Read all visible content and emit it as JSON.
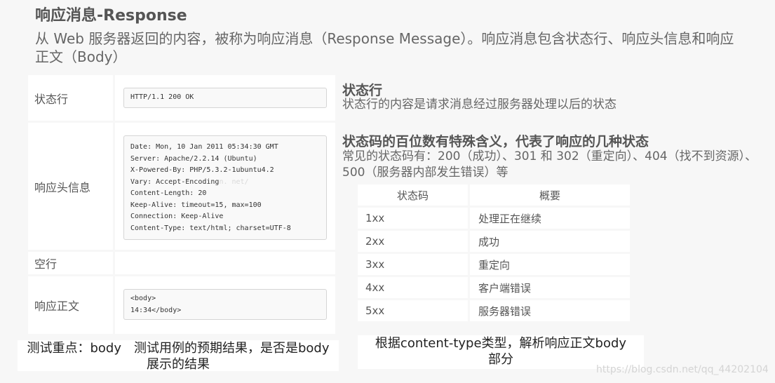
{
  "title": "响应消息-Response",
  "intro": "从 Web 服务器返回的内容，被称为响应消息（Response Message）。响应消息包含状态行、响应头信息和响应正文（Body）",
  "left_table": {
    "status_line_label": "状态行",
    "status_line_code": "HTTP/1.1 200 OK",
    "headers_label": "响应头信息",
    "headers_lines": [
      "Date: Mon, 10 Jan 2011 05:34:30 GMT",
      "Server: Apache/2.2.14 (Ubuntu)",
      "X-Powered-By: PHP/5.3.2-1ubuntu4.2",
      "Vary: Accept-Encoding",
      "Content-Length: 20",
      "Keep-Alive: timeout=15, max=100",
      "Connection: Keep-Alive",
      "Content-Type: text/html; charset=UTF-8"
    ],
    "headers_watermark": "n. net/",
    "blank_label": "空行",
    "body_label": "响应正文",
    "body_lines": [
      "<body>",
      "14:34</body>"
    ]
  },
  "status_line_section": {
    "heading": "状态行",
    "text": "状态行的内容是请求消息经过服务器处理以后的状态"
  },
  "status_code_section": {
    "heading": "状态码的百位数有特殊含义，代表了响应的几种状态",
    "text": "常见的状态码有：200（成功）、301 和 302（重定向）、404（找不到资源）、500（服务器内部发生错误）等"
  },
  "status_table": {
    "headers": [
      "状态码",
      "概要"
    ],
    "rows": [
      [
        "1xx",
        "处理正在继续"
      ],
      [
        "2xx",
        "成功"
      ],
      [
        "3xx",
        "重定向"
      ],
      [
        "4xx",
        "客户端错误"
      ],
      [
        "5xx",
        "服务器错误"
      ]
    ]
  },
  "note_left": "测试重点：body　测试用例的预期结果，是否是body展示的结果",
  "note_right": "根据content-type类型，解析响应正文body部分",
  "watermark": "https://blog.csdn.net/qq_44202104"
}
